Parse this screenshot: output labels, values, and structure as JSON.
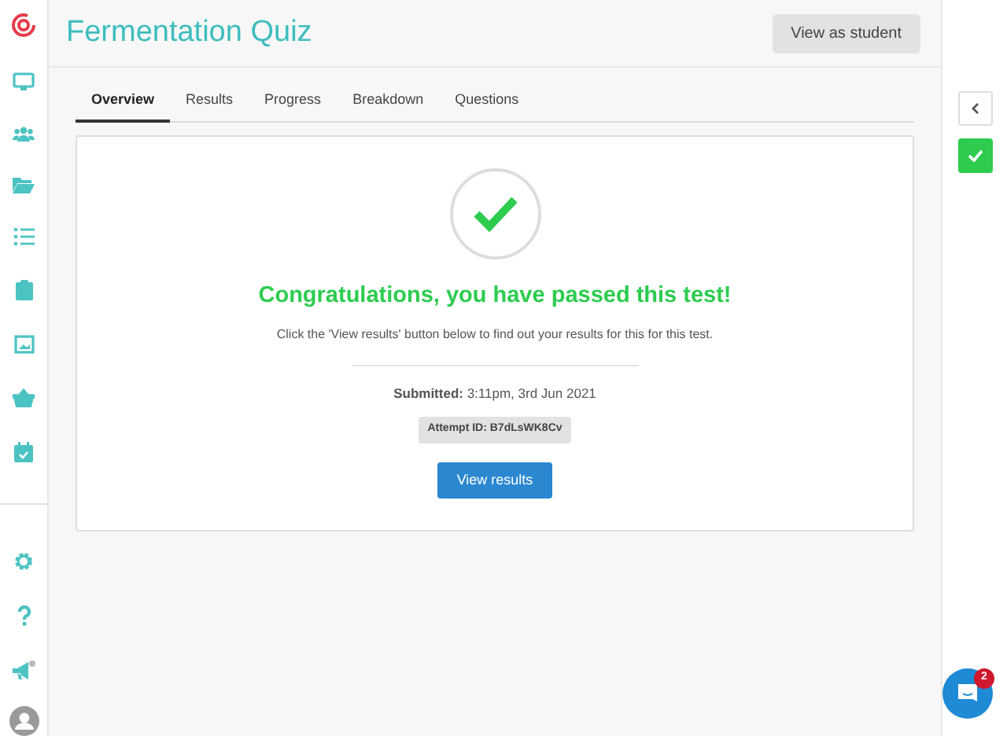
{
  "title": "Fermentation Quiz",
  "header_button": "View as student",
  "tabs": [
    {
      "label": "Overview",
      "selected": true
    },
    {
      "label": "Results",
      "selected": false
    },
    {
      "label": "Progress",
      "selected": false
    },
    {
      "label": "Breakdown",
      "selected": false
    },
    {
      "label": "Questions",
      "selected": false
    }
  ],
  "result": {
    "passed": true,
    "heading": "Congratulations, you have passed this test!",
    "message": "Click the 'View results' button below to find out your results for this for this test.",
    "submitted_label": "Submitted:",
    "submitted_value": "3:11pm, 3rd Jun 2021",
    "attempt_id": "Attempt ID: B7dLsWK8Cv",
    "button": "View results"
  },
  "chat": {
    "badge": "2"
  }
}
